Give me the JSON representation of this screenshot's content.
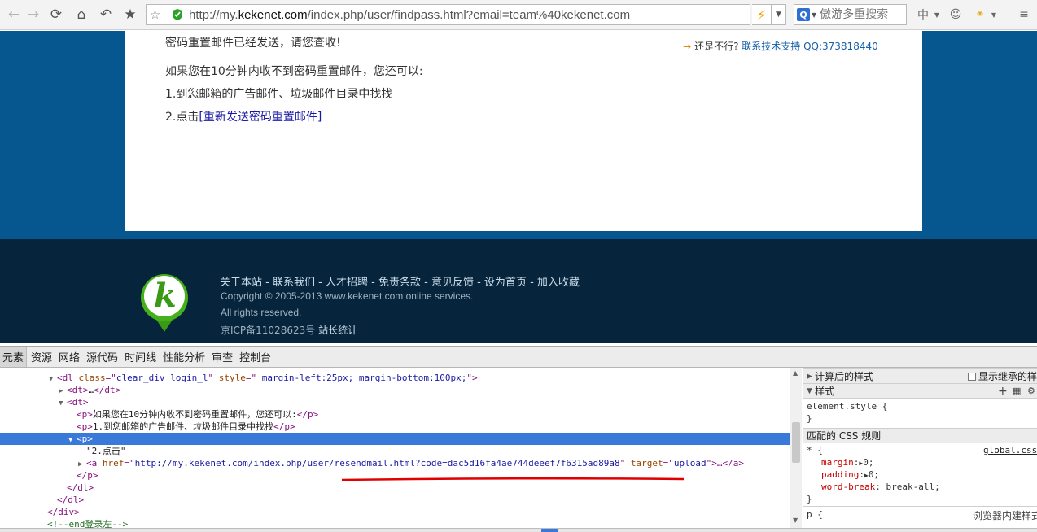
{
  "browser": {
    "url_prefix": "http://my.",
    "url_domain": "kekenet.com",
    "url_rest": "/index.php/user/findpass.html?email=team%40kekenet.com",
    "search_placeholder": "傲游多重搜索",
    "engine_glyph": "Q",
    "ime_label": "中"
  },
  "page": {
    "sent_message": "密码重置邮件已经发送，请您查收!",
    "if_not_received": "如果您在10分钟内收不到密码重置邮件，您还可以:",
    "step1": "1.到您邮箱的广告邮件、垃圾邮件目录中找找",
    "step2_prefix": "2.点击",
    "resend_link": "[重新发送密码重置邮件]",
    "help_prefix": "还是不行?",
    "help_link": "联系技术支持 QQ:373818440"
  },
  "footer": {
    "logo_letter": "k",
    "links": [
      "关于本站",
      "联系我们",
      "人才招聘",
      "免责条款",
      "意见反馈",
      "设为首页",
      "加入收藏"
    ],
    "copyright": "Copyright © 2005-2013 www.kekenet.com online services.",
    "rights": "All rights reserved.",
    "icp": "京ICP备11028623号",
    "stats_link": "站长统计"
  },
  "devtools": {
    "tabs": [
      "元素",
      "资源",
      "网络",
      "源代码",
      "时间线",
      "性能分析",
      "审查",
      "控制台"
    ],
    "computed_label": "计算后的样式",
    "show_inherited": "显示继承的样",
    "styles_label": "样式",
    "element_style": "element.style {",
    "close_brace": "}",
    "matched_rules": "匹配的 CSS 规则",
    "rule_selector": "* {",
    "rule_source": "global.css",
    "rule_props": [
      {
        "name": "margin",
        "value": "0;"
      },
      {
        "name": "padding",
        "value": "0;"
      },
      {
        "name": "word-break",
        "value": "break-all;"
      }
    ],
    "p_selector": "p {",
    "builtin_label": "浏览器内建样式",
    "dl_class": "clear_div login_l",
    "dl_style": " margin-left:25px; margin-bottom:100px;",
    "dt_collapsed": "…",
    "p1_text": "如果您在10分钟内收不到密码重置邮件，您还可以:",
    "p2_text": "1.到您邮箱的广告邮件、垃圾邮件目录中找找",
    "text_node": "\"2.点击\"",
    "a_href": "http://my.kekenet.com/index.php/user/resendmail.html?code=dac5d16fa4ae744deeef7f6315ad89a8",
    "a_target": "upload",
    "end_comment": "<!--end登录左-->"
  },
  "colors": {
    "page_blue": "#065790",
    "footer_navy": "#06243b",
    "selection_blue": "#3879d9",
    "annotation_red": "#e00000"
  }
}
